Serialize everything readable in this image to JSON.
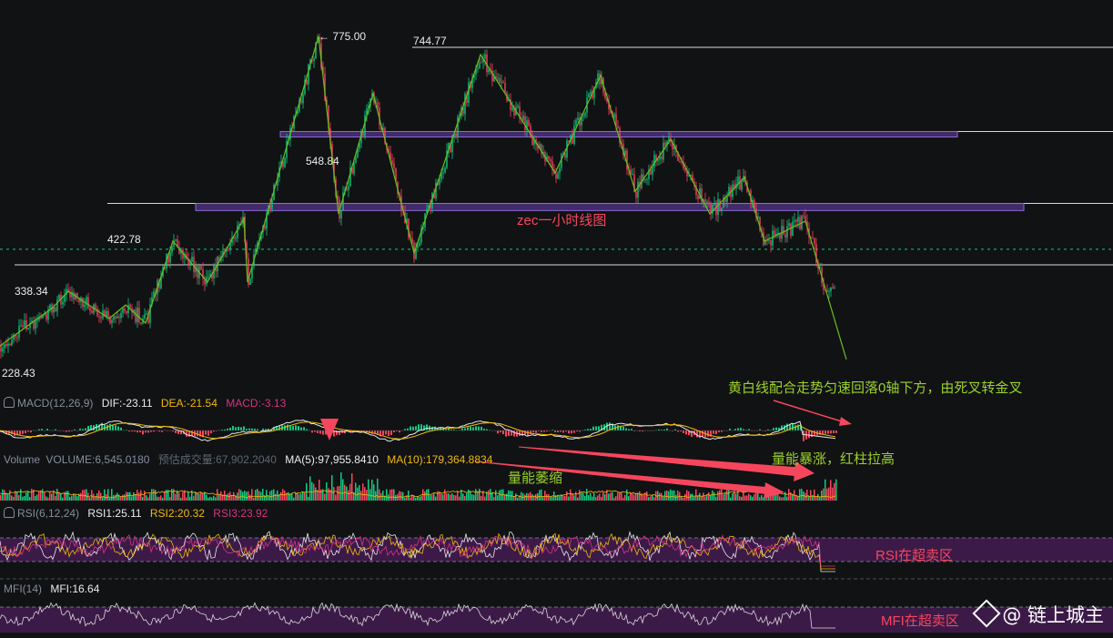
{
  "chart_title": "zec一小时线图",
  "price_levels": {
    "high_marker": "← 775.00",
    "level_744": "744.77",
    "level_548": "548.84",
    "level_422": "422.78",
    "level_338": "338.34",
    "low_label": "228.43"
  },
  "macd": {
    "name": "MACD(12,26,9)",
    "dif": "DIF:-23.11",
    "dea": "DEA:-21.54",
    "macd": "MACD:-3.13"
  },
  "volume": {
    "name": "Volume",
    "volume": "VOLUME:6,545.0180",
    "est": "预估成交量:67,902.2040",
    "ma5": "MA(5):97,955.8410",
    "ma10": "MA(10):179,364.8834"
  },
  "rsi": {
    "name": "RSI(6,12,24)",
    "rsi1": "RSI1:25.11",
    "rsi2": "RSI2:20.32",
    "rsi3": "RSI3:23.92"
  },
  "mfi": {
    "name": "MFI(14)",
    "mfi": "MFI:16.64"
  },
  "annotations": {
    "macd_note": "黄白线配合走势匀速回落0轴下方，由死叉转金叉",
    "volume_shrink": "量能萎缩",
    "volume_surge": "量能暴涨，红柱拉高",
    "rsi_note": "RSI在超卖区",
    "mfi_note": "MFI在超卖区"
  },
  "watermark": "@ 链上城主",
  "colors": {
    "up": "#0ecb81",
    "down": "#f6465d",
    "zigzag": "#6bbf1f",
    "zone": "#6a3fb0",
    "dif": "#e8e8e8",
    "dea": "#f0b90b",
    "rsi1": "#e8e8e8",
    "rsi2": "#f0b90b",
    "rsi3": "#d63384",
    "annot_green": "#9bd12a",
    "annot_red": "#f6465d"
  },
  "chart_data": {
    "type": "candlestick",
    "ylim": [
      228.43,
      775.0
    ],
    "zigzag": [
      [
        0,
        380
      ],
      [
        58,
        338
      ],
      [
        75,
        320
      ],
      [
        120,
        350
      ],
      [
        138,
        335
      ],
      [
        160,
        355
      ],
      [
        190,
        265
      ],
      [
        228,
        310
      ],
      [
        268,
        240
      ],
      [
        272,
        310
      ],
      [
        350,
        40
      ],
      [
        372,
        235
      ],
      [
        410,
        103
      ],
      [
        455,
        278
      ],
      [
        528,
        60
      ],
      [
        610,
        190
      ],
      [
        660,
        83
      ],
      [
        698,
        210
      ],
      [
        737,
        153
      ],
      [
        780,
        235
      ],
      [
        818,
        195
      ],
      [
        840,
        265
      ],
      [
        885,
        243
      ],
      [
        930,
        395
      ]
    ],
    "horizontal_levels": [
      {
        "value": 744.77
      },
      {
        "value": 548.84
      },
      {
        "value": 422.78
      },
      {
        "value": 338.34
      }
    ],
    "zones": [
      {
        "from": 540.0,
        "to": 548.84
      },
      {
        "from": 412.0,
        "to": 422.78
      }
    ],
    "last_price": 358.0
  }
}
